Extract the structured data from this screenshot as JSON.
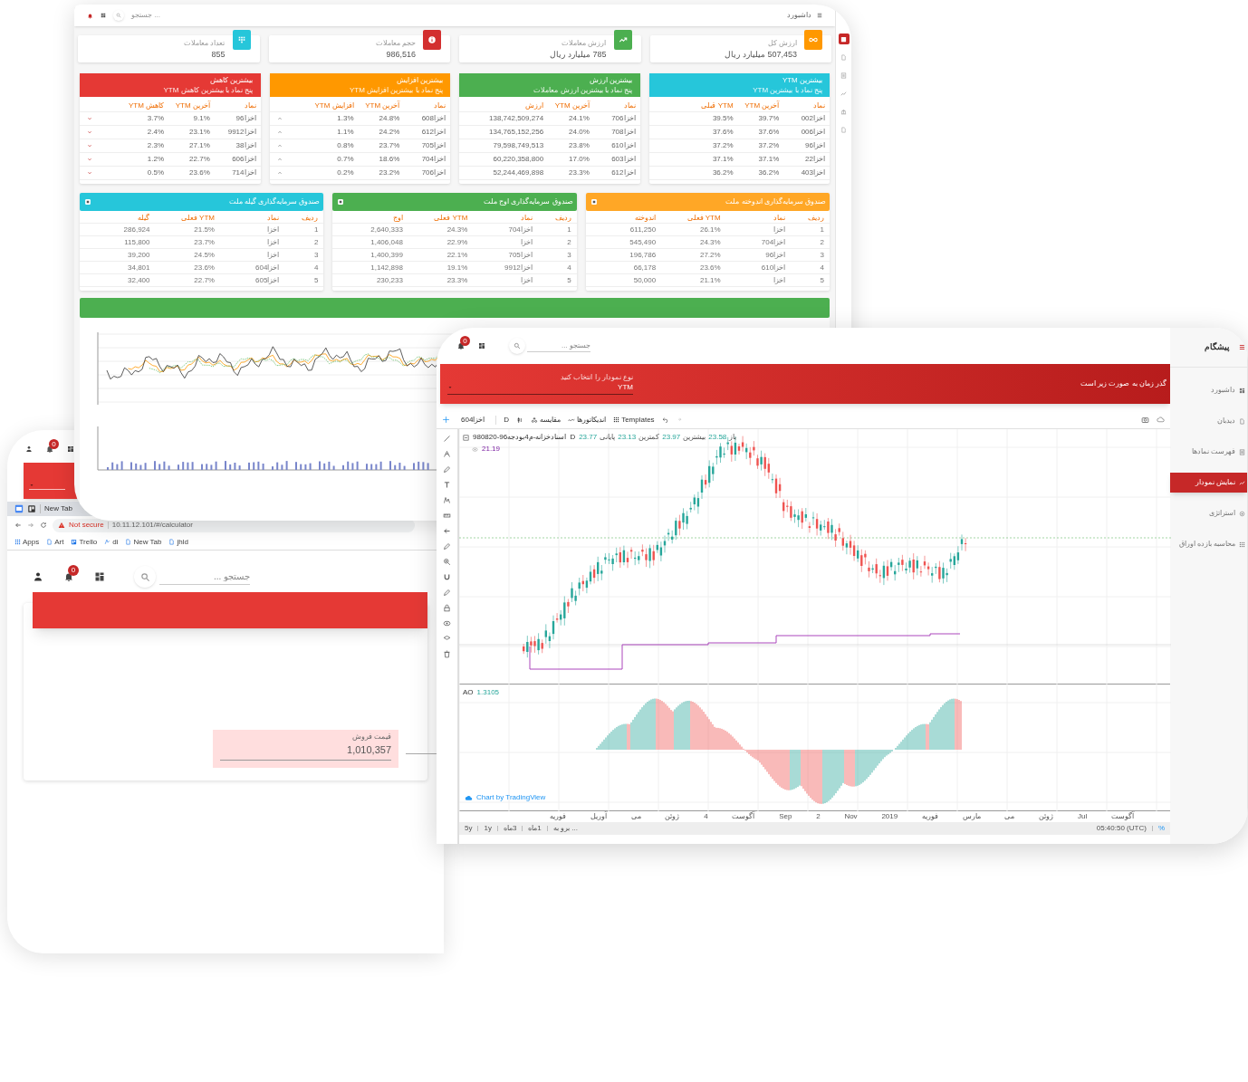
{
  "dashboard": {
    "topbar": {
      "search_placeholder": "جستجو ...",
      "page_title": "داشبورد"
    },
    "sidebar_icons": [
      {
        "selected": true
      },
      {
        "selected": false
      },
      {
        "selected": false
      },
      {
        "selected": false
      },
      {
        "selected": false
      },
      {
        "selected": false
      }
    ],
    "stat_cards": [
      {
        "label": "ارزش کل",
        "value": "507,453 میلیارد ریال",
        "color": "#ff9800"
      },
      {
        "label": "ارزش معاملات",
        "value": "785 میلیارد ریال",
        "color": "#4caf50"
      },
      {
        "label": "حجم معاملات",
        "value": "986,516",
        "color": "#d32f2f"
      },
      {
        "label": "تعداد معاملات",
        "value": "855",
        "color": "#26c6da"
      }
    ],
    "top_tables": [
      {
        "kind": "plain",
        "title": "بیشترین YTM",
        "subtitle": "پنج نماد با بیشترین YTM",
        "color": "#26c6da",
        "columns": [
          "نماد",
          "آخرین YTM",
          "YTM قبلی"
        ],
        "rows": [
          [
            "اخزا002",
            "39.7%",
            "39.5%"
          ],
          [
            "اخزا006",
            "37.6%",
            "37.6%"
          ],
          [
            "اخزا96",
            "37.2%",
            "37.2%"
          ],
          [
            "اخزا22",
            "37.1%",
            "37.1%"
          ],
          [
            "اخزا403",
            "36.2%",
            "36.2%"
          ]
        ]
      },
      {
        "kind": "plain",
        "title": "بیشترین ارزش",
        "subtitle": "پنج نماد با بیشترین ارزش معاملات",
        "color": "#4caf50",
        "columns": [
          "نماد",
          "آخرین YTM",
          "ارزش"
        ],
        "rows": [
          [
            "اخزا706",
            "24.1%",
            "138,742,509,274"
          ],
          [
            "اخزا708",
            "24.0%",
            "134,765,152,256"
          ],
          [
            "اخزا610",
            "23.8%",
            "79,598,749,513"
          ],
          [
            "اخزا603",
            "17.0%",
            "60,220,358,800"
          ],
          [
            "اخزا612",
            "23.3%",
            "52,244,469,898"
          ]
        ]
      },
      {
        "kind": "increase",
        "title": "بیشترین افزایش",
        "subtitle": "پنج نماد با بیشترین افزایش YTM",
        "color": "#ff9800",
        "columns": [
          "نماد",
          "آخرین YTM",
          "افزایش YTM"
        ],
        "rows": [
          [
            "اخزا608",
            "24.8%",
            "1.3%"
          ],
          [
            "اخزا612",
            "24.2%",
            "1.1%"
          ],
          [
            "اخزا705",
            "23.7%",
            "0.8%"
          ],
          [
            "اخزا704",
            "18.6%",
            "0.7%"
          ],
          [
            "اخزا706",
            "23.2%",
            "0.2%"
          ]
        ]
      },
      {
        "kind": "decrease",
        "title": "بیشترین کاهش",
        "subtitle": "پنج نماد با بیشترین کاهش YTM",
        "color": "#e53935",
        "columns": [
          "نماد",
          "آخرین YTM",
          "کاهش YTM"
        ],
        "rows": [
          [
            "اخزا96",
            "9.1%",
            "3.7%"
          ],
          [
            "اخزا9912",
            "23.1%",
            "2.4%"
          ],
          [
            "اخزا38",
            "27.1%",
            "2.3%"
          ],
          [
            "اخزا606",
            "22.7%",
            "1.2%"
          ],
          [
            "اخزا714",
            "23.6%",
            "0.5%"
          ]
        ]
      }
    ],
    "fund_tables": [
      {
        "title": "صندوق سرمایه‌گذاری اندوخته ملت",
        "color": "#ffa726",
        "columns": [
          "ردیف",
          "نماد",
          "YTM فعلی",
          "اندوخته"
        ],
        "rows": [
          [
            "1",
            "اخزا",
            "26.1%",
            "611,250"
          ],
          [
            "2",
            "اخزا704",
            "24.3%",
            "545,490"
          ],
          [
            "3",
            "اخزا96",
            "27.2%",
            "196,786"
          ],
          [
            "4",
            "اخزا610",
            "23.6%",
            "66,178"
          ],
          [
            "5",
            "اخزا",
            "21.1%",
            "50,000"
          ]
        ]
      },
      {
        "title": "صندوق سرمایه‌گذاری اوج ملت",
        "color": "#4caf50",
        "columns": [
          "ردیف",
          "نماد",
          "YTM فعلی",
          "اوج"
        ],
        "rows": [
          [
            "1",
            "اخزا704",
            "24.3%",
            "2,640,333"
          ],
          [
            "2",
            "اخزا",
            "22.9%",
            "1,406,048"
          ],
          [
            "3",
            "اخزا705",
            "22.1%",
            "1,400,399"
          ],
          [
            "4",
            "اخزا9912",
            "19.1%",
            "1,142,898"
          ],
          [
            "5",
            "اخزا",
            "23.3%",
            "230,233"
          ]
        ]
      },
      {
        "title": "صندوق سرمایه‌گذاری گیله ملت",
        "color": "#26c6da",
        "columns": [
          "ردیف",
          "نماد",
          "YTM فعلی",
          "گیله"
        ],
        "rows": [
          [
            "1",
            "اخزا",
            "21.5%",
            "286,924"
          ],
          [
            "2",
            "اخزا",
            "23.7%",
            "115,800"
          ],
          [
            "3",
            "اخزا",
            "24.5%",
            "39,200"
          ],
          [
            "4",
            "اخزا604",
            "23.6%",
            "34,801"
          ],
          [
            "5",
            "اخزا605",
            "22.7%",
            "32,400"
          ]
        ]
      }
    ]
  },
  "calculator": {
    "notifications": "0",
    "tabs": [
      {
        "label": "New Tab"
      }
    ],
    "address": {
      "warning": "Not secure",
      "url": "10.11.12.101/#/calculator"
    },
    "bookmarks": [
      "jhld",
      "New Tab",
      "di",
      "Trello",
      "Art",
      "Apps"
    ],
    "app_notifications": "0",
    "search_placeholder": "جستجو ...",
    "sale_price": {
      "label": "قیمت فروش",
      "value": "1,010,357"
    }
  },
  "chart_app": {
    "notifications": "0",
    "search_placeholder": "جستجو ...",
    "header": {
      "select_label": "نوع نمودار را انتخاب کنید",
      "select_value": "YTM",
      "text": "گذر زمان به صورت زیر است"
    },
    "sidebar": {
      "brand": "پیشگام",
      "items": [
        {
          "label": "داشبورد",
          "selected": false
        },
        {
          "label": "دیدبان",
          "selected": false
        },
        {
          "label": "فهرست نمادها",
          "selected": false
        },
        {
          "label": "نمایش نمودار",
          "selected": true
        },
        {
          "label": "استراتژی",
          "selected": false
        },
        {
          "label": "محاسبه بازده اوراق",
          "selected": false
        }
      ]
    },
    "toolbar": {
      "symbol": "اخزا604",
      "interval": "D",
      "compare": "مقایسه",
      "indicators": "اندیکاتورها",
      "templates": "Templates"
    },
    "legend": {
      "title": "980820-96اسنادخزانه-م4بودجه",
      "interval": "D",
      "ohlc": [
        {
          "label": "باز",
          "value": "23.58"
        },
        {
          "label": "بیشترین",
          "value": "23.97"
        },
        {
          "label": "کمترین",
          "value": "23.13"
        },
        {
          "label": "پایانی",
          "value": "23.77"
        }
      ],
      "second_value": "21.19"
    },
    "oscillator": {
      "name": "AO",
      "value": "1.3105"
    },
    "attribution": "Chart by TradingView",
    "x_labels": [
      "آگوست",
      "Jul",
      "ژوئن",
      "می",
      "مارس",
      "فوریه",
      "2019",
      "Nov",
      "2",
      "Sep",
      "آگوست",
      "4",
      "ژوئن",
      "می",
      "آوریل",
      "فوریه"
    ],
    "ranges": [
      "1ماه",
      "3ماه",
      "1y",
      "5y"
    ],
    "goto": "برو به ...",
    "clock": "05:40:50 (UTC)",
    "percent": "%"
  }
}
